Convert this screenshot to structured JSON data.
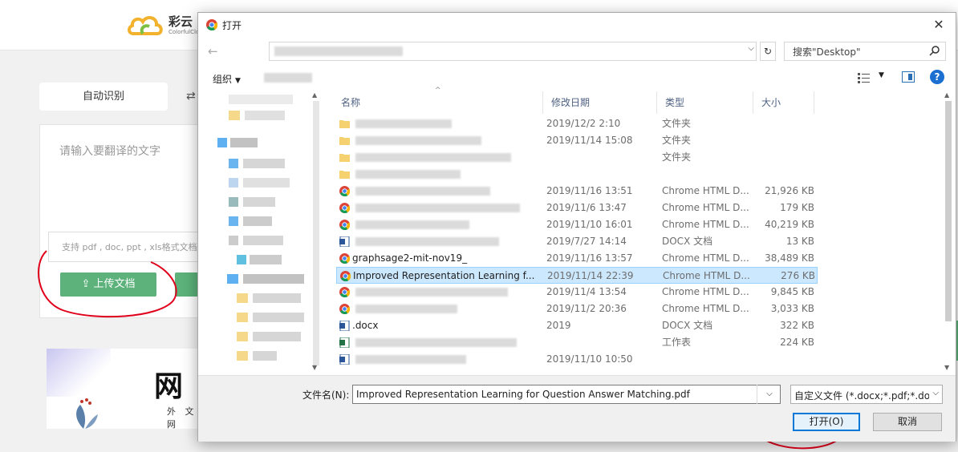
{
  "site": {
    "logo_name": "彩云",
    "logo_sub": "ColorfulClo",
    "mode_tab": "自动识别",
    "input_placeholder": "请输入要翻译的文字",
    "format_hint": "支持 pdf , doc, ppt , xls格式文档",
    "upload_label": "上传文档",
    "banner_big": "网",
    "banner_small": "外 文 网"
  },
  "dialog": {
    "title": "打开",
    "search_placeholder": "搜索\"Desktop\"",
    "organize": "组织",
    "columns": [
      "名称",
      "修改日期",
      "类型",
      "大小"
    ],
    "files": [
      {
        "name": "",
        "date": "2019/12/2 2:10",
        "type": "文件夹",
        "size": "",
        "icon": "folder",
        "selected": false
      },
      {
        "name": "",
        "date": "2019/11/14 15:08",
        "type": "文件夹",
        "size": "",
        "icon": "folder",
        "selected": false
      },
      {
        "name": "",
        "date": "",
        "type": "文件夹",
        "size": "",
        "icon": "folder",
        "selected": false
      },
      {
        "name": "",
        "date": "",
        "type": "",
        "size": "",
        "icon": "folder",
        "selected": false
      },
      {
        "name": "",
        "date": "2019/11/16 13:51",
        "type": "Chrome HTML D...",
        "size": "21,926 KB",
        "icon": "chrome",
        "selected": false
      },
      {
        "name": "",
        "date": "2019/11/6 13:47",
        "type": "Chrome HTML D...",
        "size": "179 KB",
        "icon": "chrome",
        "selected": false
      },
      {
        "name": "",
        "date": "2019/11/10 16:01",
        "type": "Chrome HTML D...",
        "size": "40,219 KB",
        "icon": "chrome",
        "selected": false
      },
      {
        "name": "",
        "date": "2019/7/27 14:14",
        "type": "DOCX 文档",
        "size": "13 KB",
        "icon": "word",
        "selected": false
      },
      {
        "name": "graphsage2-mit-nov19_",
        "date": "2019/11/16 13:57",
        "type": "Chrome HTML D...",
        "size": "38,489 KB",
        "icon": "chrome",
        "selected": false
      },
      {
        "name": "Improved Representation Learning f...",
        "date": "2019/11/14 22:39",
        "type": "Chrome HTML D...",
        "size": "276 KB",
        "icon": "chrome",
        "selected": true
      },
      {
        "name": "",
        "date": "2019/11/4 13:54",
        "type": "Chrome HTML D...",
        "size": "9,845 KB",
        "icon": "chrome",
        "selected": false
      },
      {
        "name": "",
        "date": "2019/11/2 20:36",
        "type": "Chrome HTML D...",
        "size": "3,033 KB",
        "icon": "chrome",
        "selected": false
      },
      {
        "name": ".docx",
        "date": "2019",
        "type": "DOCX 文档",
        "size": "322 KB",
        "icon": "word",
        "selected": false
      },
      {
        "name": "",
        "date": "",
        "type": "工作表",
        "size": "224 KB",
        "icon": "excel",
        "selected": false
      },
      {
        "name": "",
        "date": "2019/11/10 10:50",
        "type": "",
        "size": "",
        "icon": "word",
        "selected": false
      }
    ],
    "filename_label": "文件名(N):",
    "filename_value": "Improved Representation Learning for Question Answer Matching.pdf",
    "filetype_value": "自定义文件 (*.docx;*.pdf;*.doc",
    "open_button": "打开(O)",
    "cancel_button": "取消"
  },
  "colors": {
    "accent_green": "#5cb27a",
    "selection": "#cce8ff",
    "annotation_red": "#e0001b",
    "open_border": "#0078d7"
  }
}
